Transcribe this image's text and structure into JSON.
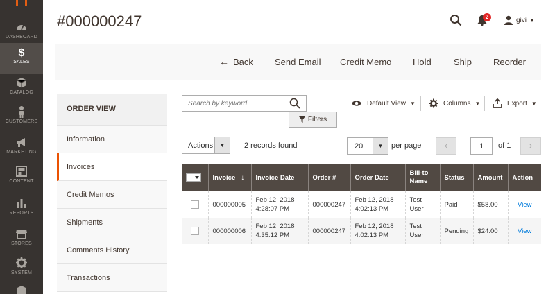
{
  "menu": {
    "items": [
      {
        "label": "Dashboard",
        "icon": "dashboard-icon"
      },
      {
        "label": "Sales",
        "icon": "dollar-icon",
        "active": true
      },
      {
        "label": "Catalog",
        "icon": "box-icon"
      },
      {
        "label": "Customers",
        "icon": "person-icon"
      },
      {
        "label": "Marketing",
        "icon": "megaphone-icon"
      },
      {
        "label": "Content",
        "icon": "layout-icon"
      },
      {
        "label": "Reports",
        "icon": "bar-chart-icon"
      },
      {
        "label": "Stores",
        "icon": "store-icon"
      },
      {
        "label": "System",
        "icon": "gear-icon"
      }
    ]
  },
  "header": {
    "title": "#000000247",
    "notifications_count": "2",
    "user_name": "givi"
  },
  "page_actions": {
    "back": "Back",
    "send_email": "Send Email",
    "credit_memo": "Credit Memo",
    "hold": "Hold",
    "ship": "Ship",
    "reorder": "Reorder"
  },
  "side_tabs": {
    "title": "ORDER VIEW",
    "items": [
      {
        "label": "Information"
      },
      {
        "label": "Invoices",
        "active": true
      },
      {
        "label": "Credit Memos"
      },
      {
        "label": "Shipments"
      },
      {
        "label": "Comments History"
      },
      {
        "label": "Transactions"
      }
    ]
  },
  "grid_toolbar": {
    "search_placeholder": "Search by keyword",
    "filters_label": "Filters",
    "view_label": "Default View",
    "columns_label": "Columns",
    "export_label": "Export",
    "actions_label": "Actions",
    "records_found": "2 records found",
    "per_page_value": "20",
    "per_page_label": "per page",
    "current_page": "1",
    "of_pages": "of 1"
  },
  "grid": {
    "columns": [
      "Invoice",
      "Invoice Date",
      "Order #",
      "Order Date",
      "Bill-to Name",
      "Status",
      "Amount",
      "Action"
    ],
    "rows": [
      {
        "invoice": "000000005",
        "invoice_date_1": "Feb 12, 2018",
        "invoice_date_2": "4:28:07 PM",
        "order": "000000247",
        "order_date_1": "Feb 12, 2018",
        "order_date_2": "4:02:13 PM",
        "bill_to_1": "Test",
        "bill_to_2": "User",
        "status": "Paid",
        "amount": "$58.00",
        "action": "View"
      },
      {
        "invoice": "000000006",
        "invoice_date_1": "Feb 12, 2018",
        "invoice_date_2": "4:35:12 PM",
        "order": "000000247",
        "order_date_1": "Feb 12, 2018",
        "order_date_2": "4:02:13 PM",
        "bill_to_1": "Test",
        "bill_to_2": "User",
        "status": "Pending",
        "amount": "$24.00",
        "action": "View"
      }
    ]
  },
  "colors": {
    "menu_bg": "#373330",
    "grid_header_bg": "#514943",
    "accent": "#eb5202",
    "link": "#007bdb",
    "badge": "#e22626"
  }
}
